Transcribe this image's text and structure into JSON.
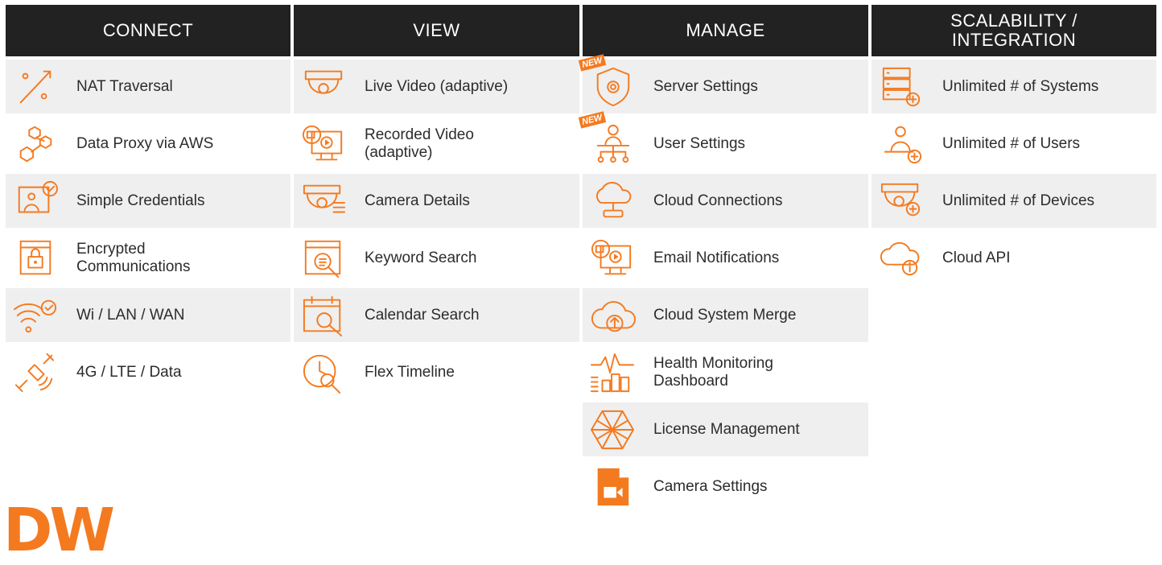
{
  "accent_color": "#f47a20",
  "header_color": "#222222",
  "columns": [
    {
      "title": "CONNECT",
      "items": [
        {
          "label": "NAT Traversal",
          "icon": "nat-traversal-icon"
        },
        {
          "label": "Data Proxy via AWS",
          "icon": "data-proxy-icon"
        },
        {
          "label": "Simple Credentials",
          "icon": "credentials-icon"
        },
        {
          "label": "Encrypted\nCommunications",
          "icon": "lock-window-icon"
        },
        {
          "label": "Wi / LAN / WAN",
          "icon": "wifi-icon"
        },
        {
          "label": "4G / LTE / Data",
          "icon": "satellite-icon"
        }
      ]
    },
    {
      "title": "VIEW",
      "items": [
        {
          "label": "Live Video (adaptive)",
          "icon": "dome-camera-icon"
        },
        {
          "label": "Recorded Video\n(adaptive)",
          "icon": "recorded-video-icon"
        },
        {
          "label": "Camera Details",
          "icon": "camera-details-icon"
        },
        {
          "label": "Keyword Search",
          "icon": "keyword-search-icon"
        },
        {
          "label": "Calendar Search",
          "icon": "calendar-search-icon"
        },
        {
          "label": "Flex Timeline",
          "icon": "timeline-clock-icon"
        }
      ]
    },
    {
      "title": "MANAGE",
      "items": [
        {
          "label": "Server Settings",
          "icon": "shield-gear-icon",
          "badge": "NEW"
        },
        {
          "label": "User Settings",
          "icon": "user-network-icon",
          "badge": "NEW"
        },
        {
          "label": "Cloud Connections",
          "icon": "cloud-connection-icon"
        },
        {
          "label": "Email Notifications",
          "icon": "email-video-icon"
        },
        {
          "label": "Cloud System Merge",
          "icon": "cloud-upload-icon"
        },
        {
          "label": "Health Monitoring\nDashboard",
          "icon": "health-chart-icon"
        },
        {
          "label": "License Management",
          "icon": "license-hexagon-icon"
        },
        {
          "label": "Camera Settings",
          "icon": "camera-file-icon"
        }
      ]
    },
    {
      "title": "SCALABILITY /\nINTEGRATION",
      "items": [
        {
          "label": "Unlimited # of Systems",
          "icon": "server-plus-icon"
        },
        {
          "label": "Unlimited # of Users",
          "icon": "user-plus-icon"
        },
        {
          "label": "Unlimited # of Devices",
          "icon": "camera-plus-icon"
        },
        {
          "label": "Cloud API",
          "icon": "cloud-info-icon"
        }
      ]
    }
  ],
  "logo_text": "DW"
}
